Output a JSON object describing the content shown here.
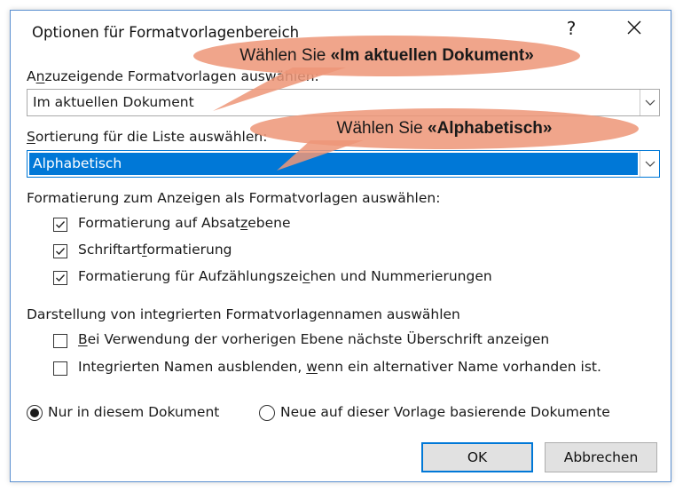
{
  "dialog": {
    "title": "Optionen für Formatvorlagenbereich",
    "help_label": "?",
    "close_icon": "close-icon"
  },
  "show_styles": {
    "label_pre": "A",
    "label_u": "n",
    "label_post": "zuzeigende Formatvorlagen auswählen:",
    "value": "Im aktuellen Dokument"
  },
  "sort": {
    "label_u": "S",
    "label_post": "ortierung für die Liste auswählen:",
    "value": "Alphabetisch"
  },
  "format_section": {
    "label": "Formatierung zum Anzeigen als Formatvorlagen auswählen:",
    "items": [
      {
        "pre": "Formatierung auf Absat",
        "u": "z",
        "post": "ebene",
        "checked": true
      },
      {
        "pre": "Schriftart",
        "u": "f",
        "post": "ormatierung",
        "checked": true
      },
      {
        "pre": "Formatierung für Aufzählungszei",
        "u": "c",
        "post": "hen und Nummerierungen",
        "checked": true
      }
    ]
  },
  "builtin_section": {
    "label": "Darstellung von integrierten Formatvorlagennamen auswählen",
    "items": [
      {
        "pre": "",
        "u": "B",
        "post": "ei Verwendung der vorherigen Ebene nächste Überschrift anzeigen",
        "checked": false
      },
      {
        "pre": "Integrierten Namen ausblenden, ",
        "u": "w",
        "post": "enn ein alternativer Name vorhanden ist.",
        "checked": false
      }
    ]
  },
  "scope": {
    "option1": "Nur in diesem Dokument",
    "option1_selected": true,
    "option2": "Neue auf dieser Vorlage basierende Dokumente",
    "option2_selected": false
  },
  "buttons": {
    "ok": "OK",
    "cancel": "Abbrechen"
  },
  "callouts": [
    {
      "prefix": "Wählen Sie ",
      "bold": "«Im aktuellen Dokument»"
    },
    {
      "prefix": "Wählen Sie ",
      "bold": "«Alphabetisch»"
    }
  ],
  "colors": {
    "accent": "#0078d7",
    "callout": "#ee9678"
  }
}
